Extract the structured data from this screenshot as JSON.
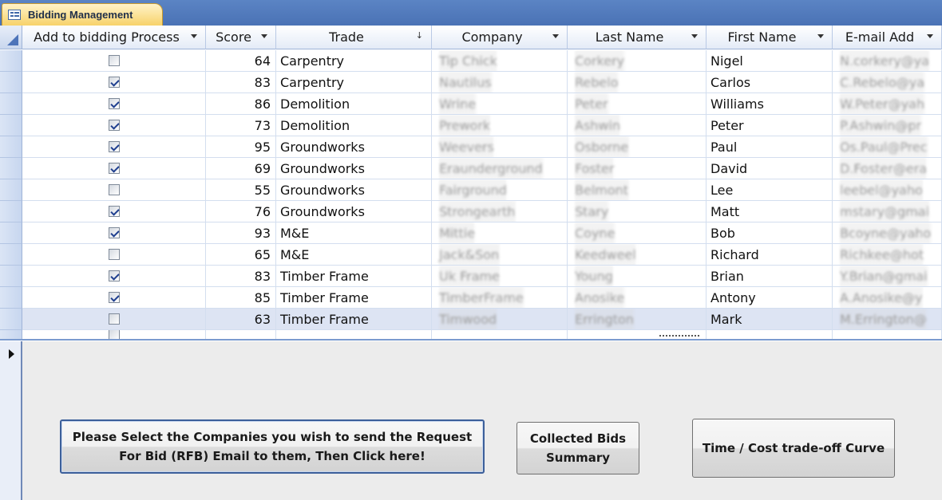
{
  "tab": {
    "title": "Bidding Management"
  },
  "columns": [
    {
      "label": "Add to bidding Process",
      "indicator": "dropdown"
    },
    {
      "label": "Score",
      "indicator": "dropdown"
    },
    {
      "label": "Trade",
      "indicator": "sorted"
    },
    {
      "label": "Company",
      "indicator": "dropdown"
    },
    {
      "label": "Last Name",
      "indicator": "dropdown"
    },
    {
      "label": "First Name",
      "indicator": "dropdown"
    },
    {
      "label": "E-mail Add",
      "indicator": "dropdown"
    }
  ],
  "rows": [
    {
      "checked": false,
      "score": "64",
      "trade": "Carpentry",
      "company": "Tip Chick",
      "last_name": "Corkery",
      "first_name": "Nigel",
      "email": "N.corkery@ya"
    },
    {
      "checked": true,
      "score": "83",
      "trade": "Carpentry",
      "company": "Nautilus",
      "last_name": "Rebelo",
      "first_name": "Carlos",
      "email": "C.Rebelo@ya"
    },
    {
      "checked": true,
      "score": "86",
      "trade": "Demolition",
      "company": "Wrine",
      "last_name": "Peter",
      "first_name": "Williams",
      "email": "W.Peter@yah"
    },
    {
      "checked": true,
      "score": "73",
      "trade": "Demolition",
      "company": "Prework",
      "last_name": "Ashwin",
      "first_name": "Peter",
      "email": "P.Ashwin@pr"
    },
    {
      "checked": true,
      "score": "95",
      "trade": "Groundworks",
      "company": "Weevers",
      "last_name": "Osborne",
      "first_name": "Paul",
      "email": "Os.Paul@Prec"
    },
    {
      "checked": true,
      "score": "69",
      "trade": "Groundworks",
      "company": "Eraunderground",
      "last_name": "Foster",
      "first_name": "David",
      "email": "D.Foster@era"
    },
    {
      "checked": false,
      "score": "55",
      "trade": "Groundworks",
      "company": "Fairground",
      "last_name": "Belmont",
      "first_name": "Lee",
      "email": "leebel@yaho"
    },
    {
      "checked": true,
      "score": "76",
      "trade": "Groundworks",
      "company": "Strongearth",
      "last_name": "Stary",
      "first_name": "Matt",
      "email": "mstary@gmai"
    },
    {
      "checked": true,
      "score": "93",
      "trade": "M&E",
      "company": "Mittie",
      "last_name": "Coyne",
      "first_name": "Bob",
      "email": "Bcoyne@yaho"
    },
    {
      "checked": false,
      "score": "65",
      "trade": "M&E",
      "company": "Jack&Son",
      "last_name": "Keedweel",
      "first_name": "Richard",
      "email": "Richkee@hot"
    },
    {
      "checked": true,
      "score": "83",
      "trade": "Timber Frame",
      "company": "Uk Frame",
      "last_name": "Young",
      "first_name": "Brian",
      "email": "Y.Brian@gmai"
    },
    {
      "checked": true,
      "score": "85",
      "trade": "Timber Frame",
      "company": "TimberFrame",
      "last_name": "Anosike",
      "first_name": "Antony",
      "email": "A.Anosike@y"
    },
    {
      "checked": false,
      "score": "63",
      "trade": "Timber Frame",
      "company": "Timwood",
      "last_name": "Errington",
      "first_name": "Mark",
      "email": "M.Errington@"
    }
  ],
  "buttons": {
    "rfb": "Please Select the Companies  you wish to send the Request For Bid (RFB) Email to them, Then Click here!",
    "collected": "Collected Bids Summary",
    "curve": "Time / Cost trade-off Curve"
  }
}
